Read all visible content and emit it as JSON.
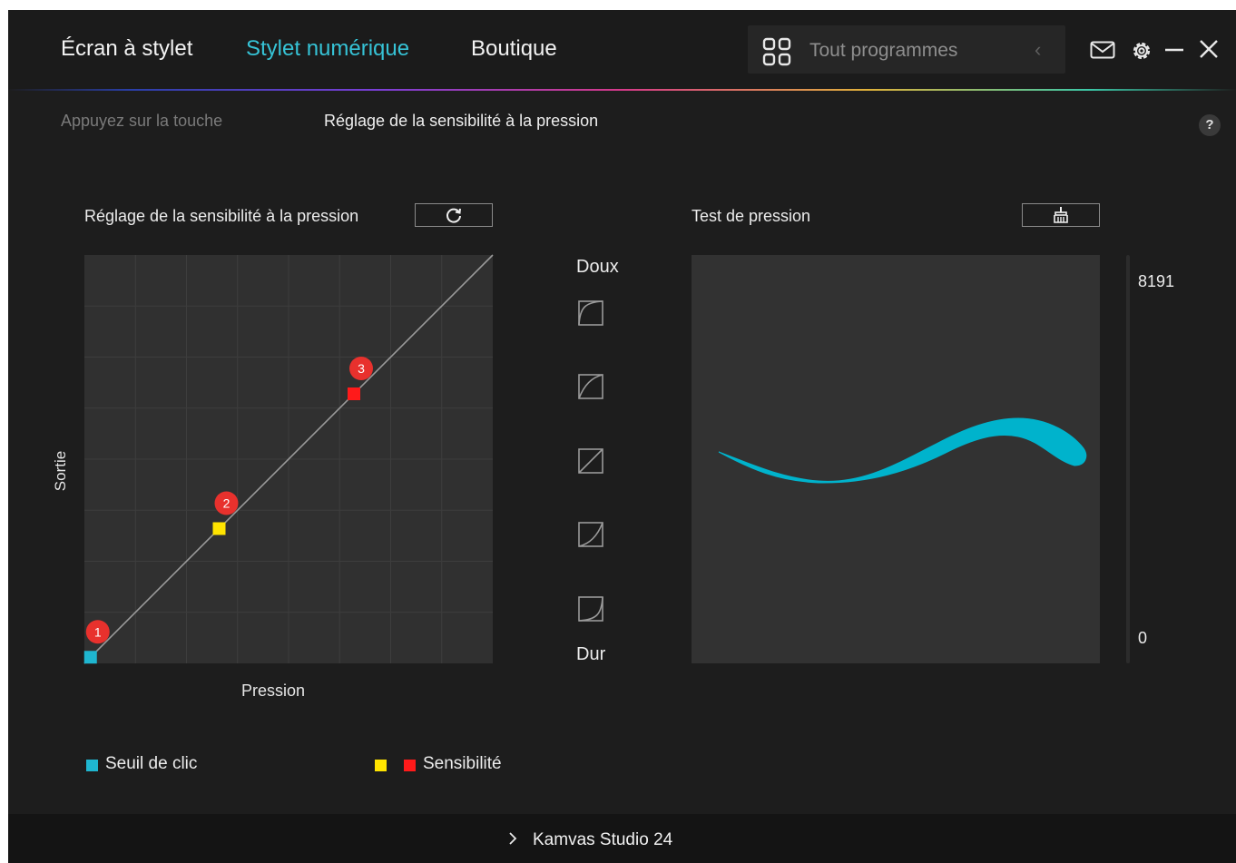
{
  "top_tabs": [
    {
      "label": "Écran à stylet",
      "active": false
    },
    {
      "label": "Stylet numérique",
      "active": true
    },
    {
      "label": "Boutique",
      "active": false
    }
  ],
  "program_selector": {
    "label": "Tout programmes",
    "icon": "grid-icon"
  },
  "window_controls": [
    "mail-icon",
    "gear-icon",
    "minimize-icon",
    "close-icon"
  ],
  "sub_tabs": [
    {
      "label": "Appuyez sur la touche",
      "active": false
    },
    {
      "label": "Réglage de la sensibilité à la pression",
      "active": true
    }
  ],
  "help_label": "?",
  "pressure_panel": {
    "title": "Réglage de la sensibilité à la pression",
    "reset_icon": "refresh-icon",
    "xlabel": "Pression",
    "ylabel": "Sortie",
    "points": [
      {
        "label": "1",
        "color": "#1fb6d0"
      },
      {
        "label": "2",
        "color": "#ffe400"
      },
      {
        "label": "3",
        "color": "#ff1a1a"
      }
    ]
  },
  "chart_data": {
    "type": "line",
    "title": "",
    "xlabel": "Pression",
    "ylabel": "Sortie",
    "xlim": [
      0,
      1
    ],
    "ylim": [
      0,
      1
    ],
    "grid": true,
    "series": [
      {
        "x": [
          0,
          1
        ],
        "y": [
          0,
          1
        ],
        "color": "#9a9a9a"
      }
    ],
    "control_points": [
      {
        "label": "1",
        "x": 0.015,
        "y": 0.015,
        "color": "#1fb6d0"
      },
      {
        "label": "2",
        "x": 0.33,
        "y": 0.33,
        "color": "#ffe400"
      },
      {
        "label": "3",
        "x": 0.66,
        "y": 0.66,
        "color": "#ff1a1a"
      }
    ]
  },
  "legend": {
    "threshold_label": "Seuil de clic",
    "threshold_color": "#1fb6d0",
    "sensitivity_label": "Sensibilité",
    "sensitivity_colors": [
      "#ffe400",
      "#ff1a1a"
    ]
  },
  "presets": {
    "top_label": "Doux",
    "bottom_label": "Dur",
    "items": [
      "soft-curve-icon",
      "medium-soft-curve-icon",
      "linear-curve-icon",
      "medium-hard-curve-icon",
      "hard-curve-icon"
    ]
  },
  "pressure_test": {
    "title": "Test de pression",
    "clear_icon": "broom-icon",
    "stroke_color": "#00b3cc",
    "max_value": "8191",
    "min_value": "0"
  },
  "footer": {
    "device_label": "Kamvas Studio 24"
  }
}
